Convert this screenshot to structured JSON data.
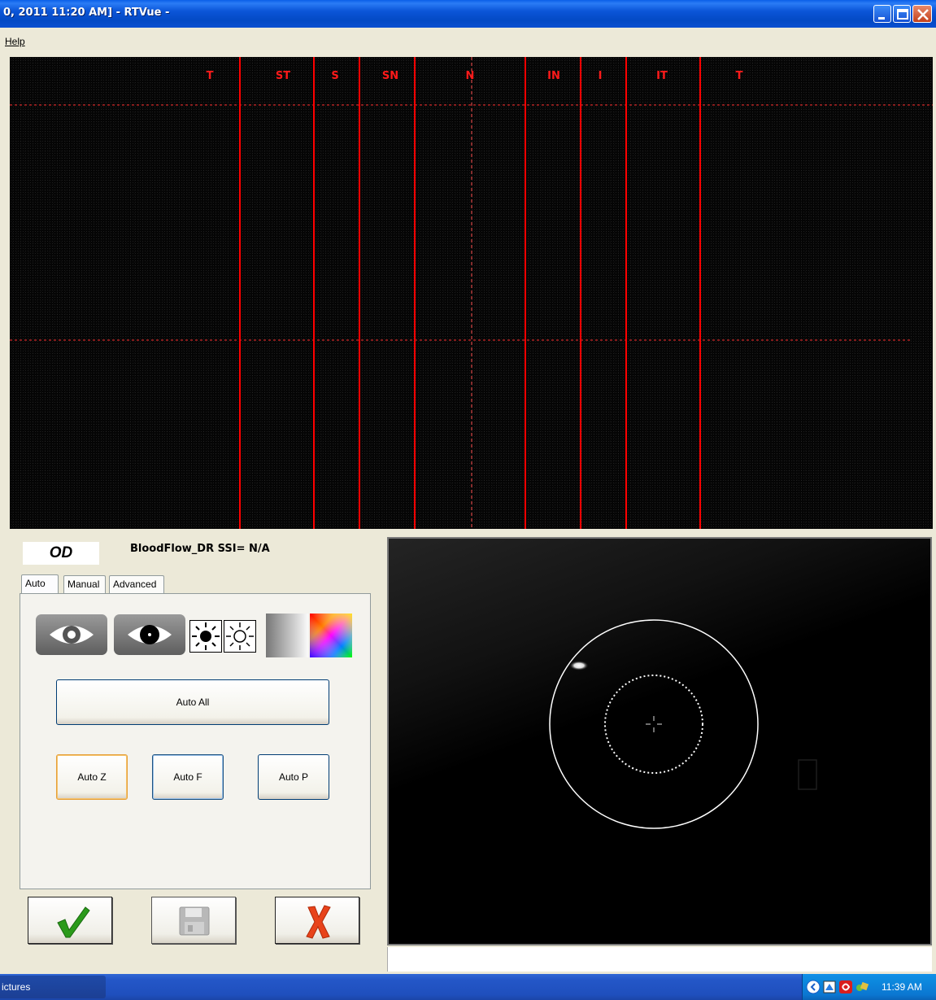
{
  "window": {
    "title": "0, 2011 11:20 AM]  - RTVue -"
  },
  "menu": {
    "help": "Help"
  },
  "scan": {
    "sectors": [
      "T",
      "ST",
      "S",
      "SN",
      "N",
      "IN",
      "I",
      "IT",
      "T"
    ],
    "line_color": "#ff0000"
  },
  "control": {
    "eye": "OD",
    "scan_info": "BloodFlow_DR  SSI= N/A",
    "tabs": [
      "Auto",
      "Manual",
      "Advanced"
    ],
    "auto_all": "Auto All",
    "auto_z": "Auto Z",
    "auto_f": "Auto F",
    "auto_p": "Auto P",
    "icons": [
      "eye-open-icon",
      "eye-pupil-icon",
      "brightness-high-icon",
      "brightness-low-icon",
      "grayscale-icon",
      "color-palette-icon"
    ]
  },
  "actions": {
    "ok_icon": "checkmark-icon",
    "save_icon": "floppy-disk-icon",
    "cancel_icon": "x-cancel-icon"
  },
  "taskbar": {
    "item": "ictures",
    "time": "11:39 AM"
  },
  "colors": {
    "accent": "#0a55d8",
    "scan_red": "#ff1a1a",
    "ok_green": "#2a9a1a",
    "cancel_red": "#e8431a"
  }
}
